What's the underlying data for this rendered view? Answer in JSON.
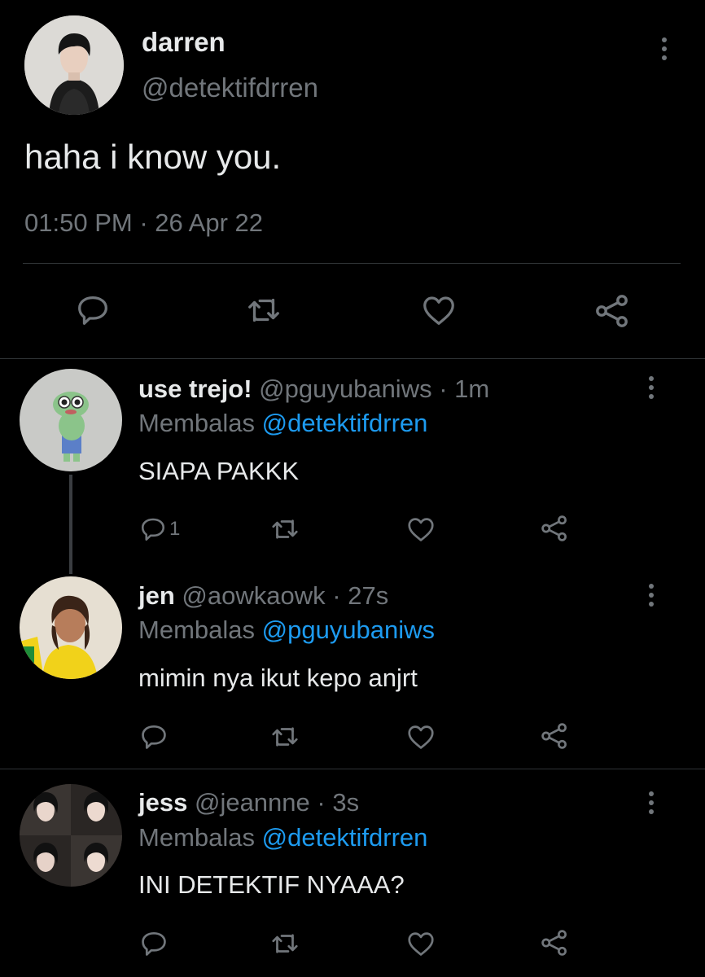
{
  "main_tweet": {
    "display_name": "darren",
    "handle": "@detektifdrren",
    "text": "haha i know you.",
    "time": "01:50 PM",
    "separator": "·",
    "date": "26 Apr 22"
  },
  "replies": [
    {
      "display_name": "use trejo!",
      "handle": "@pguyubaniws",
      "separator": "·",
      "age": "1m",
      "replying_prefix": "Membalas",
      "replying_to": "@detektifdrren",
      "text": "SIAPA PAKKK",
      "reply_count": "1"
    },
    {
      "display_name": "jen",
      "handle": "@aowkaowk",
      "separator": "·",
      "age": "27s",
      "replying_prefix": "Membalas",
      "replying_to": "@pguyubaniws",
      "text": "mimin nya ikut kepo anjrt",
      "reply_count": ""
    },
    {
      "display_name": "jess",
      "handle": "@jeannne",
      "separator": "·",
      "age": "3s",
      "replying_prefix": "Membalas",
      "replying_to": "@detektifdrren",
      "text": "INI DETEKTIF NYAAA?",
      "reply_count": ""
    }
  ],
  "colors": {
    "background": "#000000",
    "text": "#e7e9ea",
    "secondary": "#71767b",
    "accent": "#1d9bf0",
    "divider": "#2f3336"
  },
  "icons": [
    "reply-icon",
    "retweet-icon",
    "like-icon",
    "share-icon",
    "more-options-icon"
  ]
}
